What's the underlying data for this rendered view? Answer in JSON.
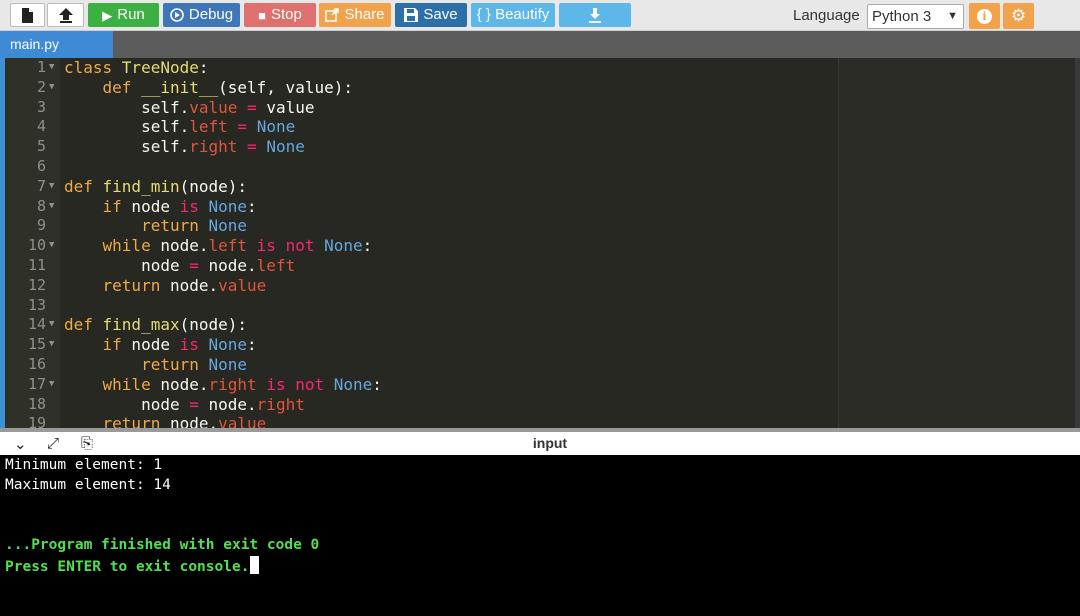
{
  "toolbar": {
    "run_label": "Run",
    "debug_label": "Debug",
    "stop_label": "Stop",
    "share_label": "Share",
    "save_label": "Save",
    "beautify_label": "{ } Beautify",
    "language_label": "Language",
    "language_value": "Python 3",
    "info_glyph": "i",
    "icons": [
      "file-icon",
      "upload-icon",
      "play-icon",
      "debug-icon",
      "stop-icon",
      "share-icon",
      "save-icon",
      "download-icon",
      "info-icon",
      "gear-icon"
    ]
  },
  "tabs": [
    {
      "label": "main.py",
      "active": true
    }
  ],
  "editor": {
    "lines": [
      {
        "n": "1",
        "fold": true,
        "tokens": [
          [
            "kw",
            "class "
          ],
          [
            "fn",
            "TreeNode"
          ],
          [
            "t",
            ":"
          ]
        ]
      },
      {
        "n": "2",
        "fold": true,
        "tokens": [
          [
            "t",
            "    "
          ],
          [
            "kw",
            "def "
          ],
          [
            "fn",
            "__init__"
          ],
          [
            "t",
            "(self, value):"
          ]
        ]
      },
      {
        "n": "3",
        "fold": false,
        "tokens": [
          [
            "t",
            "        self."
          ],
          [
            "attr",
            "value"
          ],
          [
            "t",
            " "
          ],
          [
            "op",
            "="
          ],
          [
            "t",
            " value"
          ]
        ]
      },
      {
        "n": "4",
        "fold": false,
        "tokens": [
          [
            "t",
            "        self."
          ],
          [
            "attr",
            "left"
          ],
          [
            "t",
            " "
          ],
          [
            "op",
            "="
          ],
          [
            "t",
            " "
          ],
          [
            "const",
            "None"
          ]
        ]
      },
      {
        "n": "5",
        "fold": false,
        "tokens": [
          [
            "t",
            "        self."
          ],
          [
            "attr",
            "right"
          ],
          [
            "t",
            " "
          ],
          [
            "op",
            "="
          ],
          [
            "t",
            " "
          ],
          [
            "const",
            "None"
          ]
        ]
      },
      {
        "n": "6",
        "fold": false,
        "tokens": []
      },
      {
        "n": "7",
        "fold": true,
        "tokens": [
          [
            "kw",
            "def "
          ],
          [
            "fn",
            "find_min"
          ],
          [
            "t",
            "(node):"
          ]
        ]
      },
      {
        "n": "8",
        "fold": true,
        "tokens": [
          [
            "t",
            "    "
          ],
          [
            "kw",
            "if"
          ],
          [
            "t",
            " node "
          ],
          [
            "op",
            "is"
          ],
          [
            "t",
            " "
          ],
          [
            "const",
            "None"
          ],
          [
            "t",
            ":"
          ]
        ]
      },
      {
        "n": "9",
        "fold": false,
        "tokens": [
          [
            "t",
            "        "
          ],
          [
            "kw",
            "return"
          ],
          [
            "t",
            " "
          ],
          [
            "const",
            "None"
          ]
        ]
      },
      {
        "n": "10",
        "fold": true,
        "tokens": [
          [
            "t",
            "    "
          ],
          [
            "kw",
            "while"
          ],
          [
            "t",
            " node."
          ],
          [
            "attr",
            "left"
          ],
          [
            "t",
            " "
          ],
          [
            "op",
            "is not"
          ],
          [
            "t",
            " "
          ],
          [
            "const",
            "None"
          ],
          [
            "t",
            ":"
          ]
        ]
      },
      {
        "n": "11",
        "fold": false,
        "tokens": [
          [
            "t",
            "        node "
          ],
          [
            "op",
            "="
          ],
          [
            "t",
            " node."
          ],
          [
            "attr",
            "left"
          ]
        ]
      },
      {
        "n": "12",
        "fold": false,
        "tokens": [
          [
            "t",
            "    "
          ],
          [
            "kw",
            "return"
          ],
          [
            "t",
            " node."
          ],
          [
            "attr",
            "value"
          ]
        ]
      },
      {
        "n": "13",
        "fold": false,
        "tokens": []
      },
      {
        "n": "14",
        "fold": true,
        "tokens": [
          [
            "kw",
            "def "
          ],
          [
            "fn",
            "find_max"
          ],
          [
            "t",
            "(node):"
          ]
        ]
      },
      {
        "n": "15",
        "fold": true,
        "tokens": [
          [
            "t",
            "    "
          ],
          [
            "kw",
            "if"
          ],
          [
            "t",
            " node "
          ],
          [
            "op",
            "is"
          ],
          [
            "t",
            " "
          ],
          [
            "const",
            "None"
          ],
          [
            "t",
            ":"
          ]
        ]
      },
      {
        "n": "16",
        "fold": false,
        "tokens": [
          [
            "t",
            "        "
          ],
          [
            "kw",
            "return"
          ],
          [
            "t",
            " "
          ],
          [
            "const",
            "None"
          ]
        ]
      },
      {
        "n": "17",
        "fold": true,
        "tokens": [
          [
            "t",
            "    "
          ],
          [
            "kw",
            "while"
          ],
          [
            "t",
            " node."
          ],
          [
            "attr",
            "right"
          ],
          [
            "t",
            " "
          ],
          [
            "op",
            "is not"
          ],
          [
            "t",
            " "
          ],
          [
            "const",
            "None"
          ],
          [
            "t",
            ":"
          ]
        ]
      },
      {
        "n": "18",
        "fold": false,
        "tokens": [
          [
            "t",
            "        node "
          ],
          [
            "op",
            "="
          ],
          [
            "t",
            " node."
          ],
          [
            "attr",
            "right"
          ]
        ]
      },
      {
        "n": "19",
        "fold": false,
        "tokens": [
          [
            "t",
            "    "
          ],
          [
            "kw",
            "return"
          ],
          [
            "t",
            " node."
          ],
          [
            "attr",
            "value"
          ]
        ]
      }
    ]
  },
  "console": {
    "title": "input",
    "icons": [
      "chevron-down-icon",
      "expand-icon",
      "copy-icon"
    ],
    "output": [
      "Minimum element: 1",
      "Maximum element: 14"
    ],
    "finish_message": "...Program finished with exit code 0",
    "exit_prompt": "Press ENTER to exit console."
  },
  "colors": {
    "run": "#3cb043",
    "debug": "#3e77b8",
    "stop": "#e0706e",
    "share": "#f3a24c",
    "save": "#2d6fa9",
    "beautify": "#5db7e8",
    "tab_active": "#3e8ad4",
    "editor_bg": "#272822",
    "console_bg": "#000000",
    "console_finish": "#52e052"
  }
}
